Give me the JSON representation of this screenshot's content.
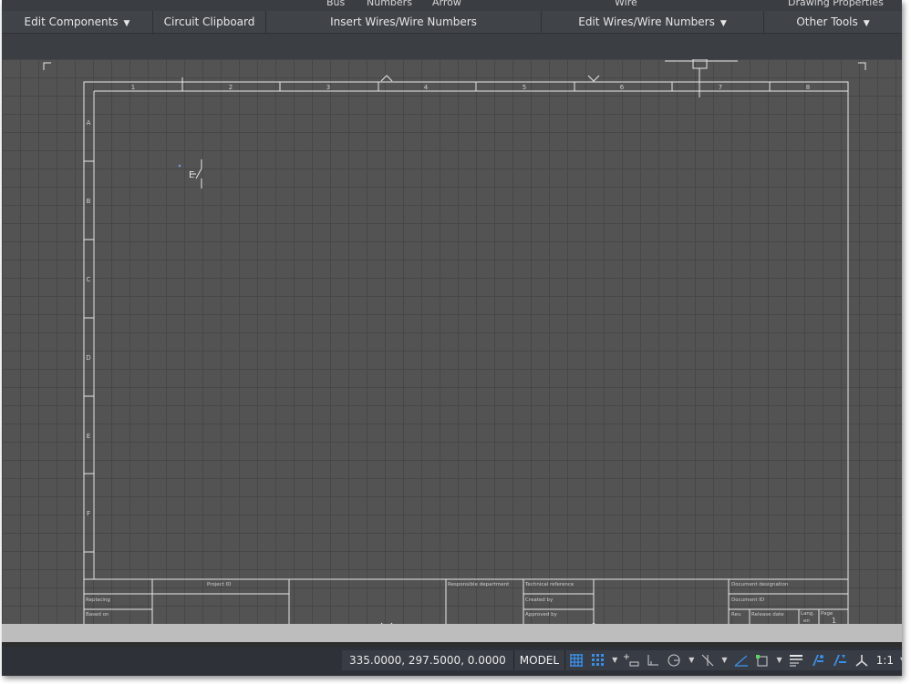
{
  "ribbon_top": {
    "items": [
      "Bus",
      "Numbers",
      "Arrow",
      "Wire",
      "Drawing Properties"
    ]
  },
  "ribbon_panels": [
    {
      "label": "Edit Components",
      "dropdown": true
    },
    {
      "label": "Circuit Clipboard",
      "dropdown": false
    },
    {
      "label": "Insert Wires/Wire Numbers",
      "dropdown": false
    },
    {
      "label": "Edit Wires/Wire Numbers",
      "dropdown": true
    },
    {
      "label": "Other Tools",
      "dropdown": true
    }
  ],
  "drawing": {
    "column_labels": [
      "1",
      "2",
      "3",
      "4",
      "5",
      "6",
      "7",
      "8"
    ],
    "row_labels": [
      "A",
      "B",
      "C",
      "D",
      "E",
      "F"
    ],
    "component_tag": "E",
    "title_block": {
      "project_id": "Project ID",
      "replacing": "Replacing",
      "based_on": "Based on",
      "responsible_department": "Responsible department",
      "technical_reference": "Technical reference",
      "created_by": "Created by",
      "approved_by": "Approved by",
      "document_designation": "Document designation",
      "document_id": "Document ID",
      "rev": "Rev.",
      "release_date": "Release date",
      "lang": "Lang.",
      "lang_value": "en",
      "page": "Page",
      "page_value": "1"
    }
  },
  "statusbar": {
    "coordinates": "335.0000, 297.5000, 0.0000",
    "model": "MODEL",
    "scale": "1:1",
    "accent_color": "#3a8ee6"
  }
}
